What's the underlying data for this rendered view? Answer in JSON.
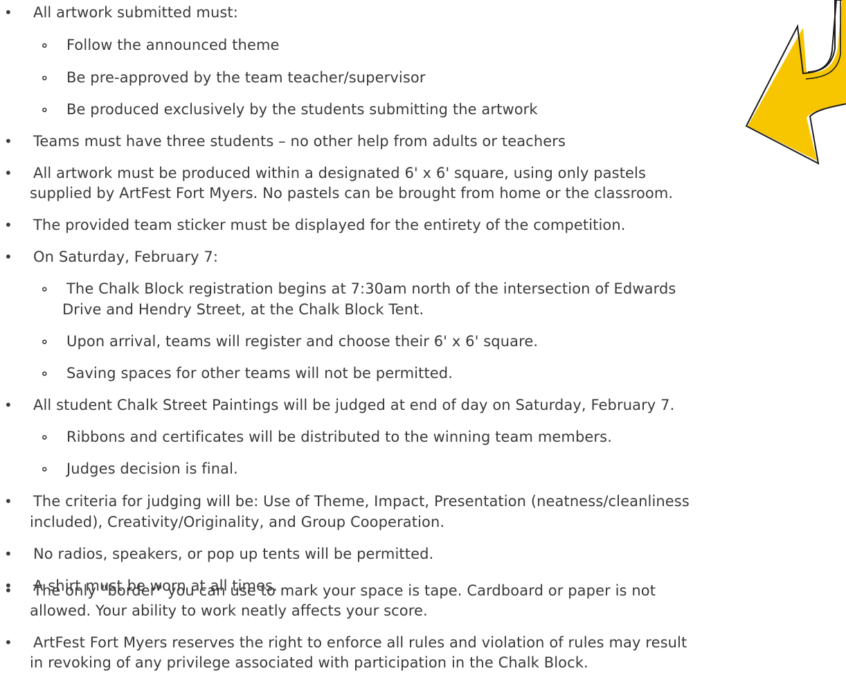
{
  "colors": {
    "text": "#3a3a3a",
    "arrow_fill": "#f7c600",
    "arrow_outline": "#1a1a1a"
  },
  "graphic": {
    "icon": "yellow-arrow-icon"
  },
  "lines": [
    {
      "level": 1,
      "bullet": "•",
      "text": "All artwork submitted must:"
    },
    {
      "level": 2,
      "bullet": "∘",
      "text": "Follow the announced theme"
    },
    {
      "level": 2,
      "bullet": "∘",
      "text": "Be pre-approved by the team teacher/supervisor"
    },
    {
      "level": 2,
      "bullet": "∘",
      "text": "Be produced exclusively by the students submitting the artwork"
    },
    {
      "level": 1,
      "bullet": "•",
      "text": "Teams must have three students – no other help from adults or teachers"
    },
    {
      "level": 1,
      "bullet": "•",
      "text": "All artwork must be produced within a designated 6' x 6' square, using only pastels"
    },
    {
      "level": 1,
      "bullet": "",
      "text": "supplied by ArtFest Fort Myers.  No pastels can be brought from home or the classroom."
    },
    {
      "level": 1,
      "bullet": "•",
      "text": "The provided team sticker must be displayed for the entirety of the competition."
    },
    {
      "level": 1,
      "bullet": "•",
      "text": "On Saturday, February 7:"
    },
    {
      "level": 2,
      "bullet": "∘",
      "text": "The Chalk Block registration begins at 7:30am north of the intersection of Edwards"
    },
    {
      "level": 2,
      "bullet": "",
      "text": "Drive and Hendry Street, at the Chalk Block Tent."
    },
    {
      "level": 2,
      "bullet": "∘",
      "text": "Upon arrival, teams will register and choose their 6' x 6' square."
    },
    {
      "level": 2,
      "bullet": "∘",
      "text": "Saving spaces for other teams will not be permitted."
    },
    {
      "level": 1,
      "bullet": "•",
      "text": "All student Chalk Street Paintings will be judged at end of day on Saturday, February 7."
    },
    {
      "level": 2,
      "bullet": "∘",
      "text": "Ribbons and certificates will be distributed to the winning team members."
    },
    {
      "level": 2,
      "bullet": "∘",
      "text": "Judges decision is final."
    },
    {
      "level": 1,
      "bullet": "•",
      "text": "The criteria for judging will be: Use of Theme, Impact, Presentation (neatness/cleanliness"
    },
    {
      "level": 1,
      "bullet": "",
      "text": "included), Creativity/Originality, and Group Cooperation."
    },
    {
      "level": 1,
      "bullet": "•",
      "text": "No radios, speakers, or pop up tents will be permitted."
    },
    {
      "level": 1,
      "bullet": "•",
      "text": "A shirt must be worn at all times."
    },
    {
      "level": 1,
      "bullet": "•",
      "text": "The only \"border\" you can use to mark your space is tape. Cardboard or paper is not"
    },
    {
      "level": 1,
      "bullet": "",
      "text": "allowed. Your ability to work neatly affects your score."
    },
    {
      "level": 1,
      "bullet": "•",
      "text": "ArtFest Fort Myers reserves the right to enforce all rules and violation of rules may result"
    },
    {
      "level": 1,
      "bullet": "",
      "text": "in revoking of any privilege associated with participation in the Chalk Block."
    }
  ]
}
